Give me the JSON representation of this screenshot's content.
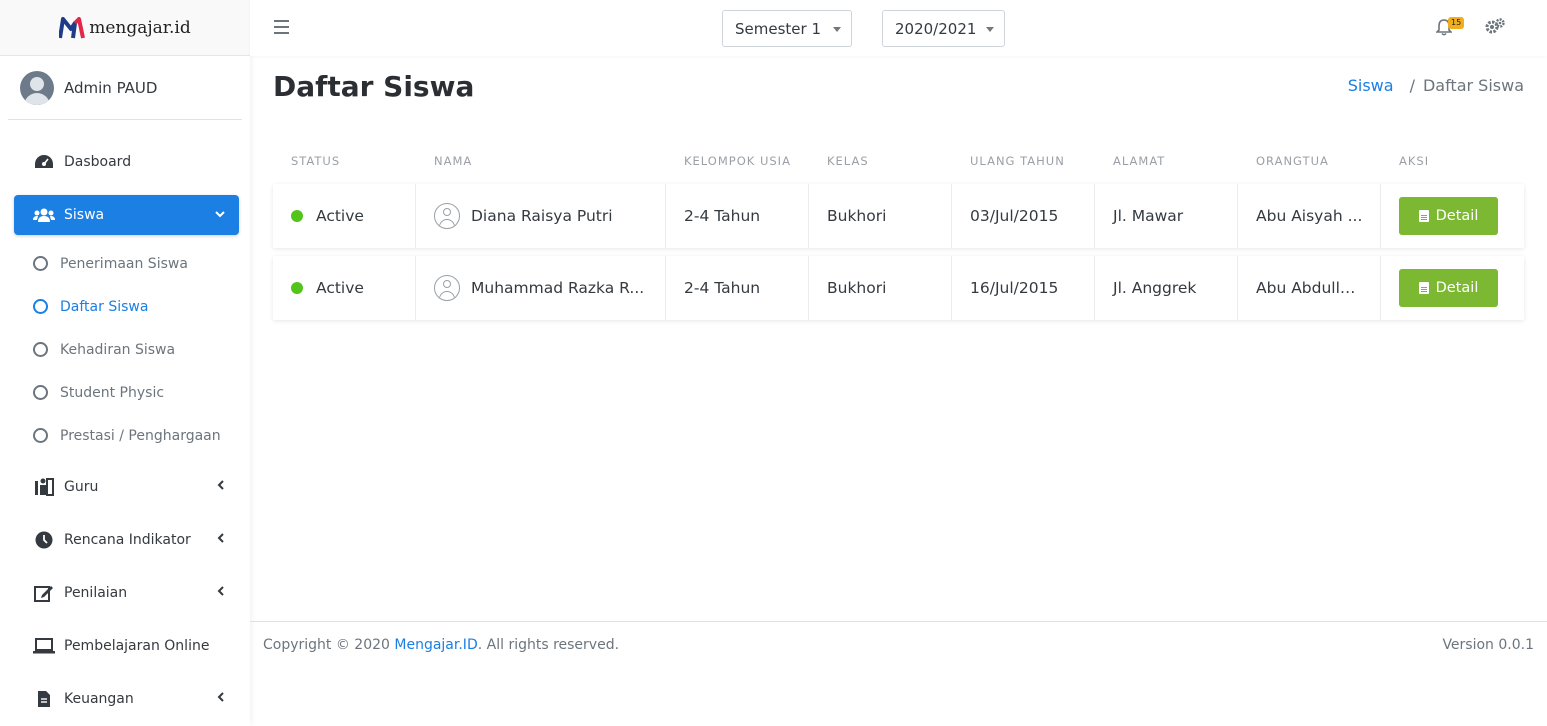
{
  "brand": {
    "name": "mengajar.id"
  },
  "user": {
    "name": "Admin PAUD"
  },
  "sidebar": {
    "items": [
      {
        "label": "Dasboard",
        "icon": "dashboard-icon"
      },
      {
        "label": "Siswa",
        "icon": "users-icon",
        "active": true
      },
      {
        "label": "Guru",
        "icon": "teacher-icon"
      },
      {
        "label": "Rencana Indikator",
        "icon": "clock-icon"
      },
      {
        "label": "Penilaian",
        "icon": "edit-icon"
      },
      {
        "label": "Pembelajaran Online",
        "icon": "laptop-icon"
      },
      {
        "label": "Keuangan",
        "icon": "file-icon"
      }
    ],
    "siswa_sub": [
      {
        "label": "Penerimaan Siswa"
      },
      {
        "label": "Daftar Siswa",
        "active": true
      },
      {
        "label": "Kehadiran Siswa"
      },
      {
        "label": "Student Physic"
      },
      {
        "label": "Prestasi / Penghargaan"
      }
    ]
  },
  "topbar": {
    "semester": "Semester 1",
    "year": "2020/2021",
    "notification_count": "15"
  },
  "page": {
    "title": "Daftar Siswa",
    "breadcrumb": {
      "link": "Siswa",
      "separator": "/",
      "current": "Daftar Siswa"
    }
  },
  "table": {
    "headers": [
      "STATUS",
      "NAMA",
      "KELOMPOK USIA",
      "KELAS",
      "ULANG TAHUN",
      "ALAMAT",
      "ORANGTUA",
      "AKSI"
    ],
    "rows": [
      {
        "status": "Active",
        "nama": "Diana Raisya Putri",
        "usia": "2-4 Tahun",
        "kelas": "Bukhori",
        "ulang_tahun": "03/Jul/2015",
        "alamat": "Jl. Mawar",
        "orangtua": "Abu Aisyah ...",
        "aksi": "Detail"
      },
      {
        "status": "Active",
        "nama": "Muhammad Razka R...",
        "usia": "2-4 Tahun",
        "kelas": "Bukhori",
        "ulang_tahun": "16/Jul/2015",
        "alamat": "Jl. Anggrek",
        "orangtua": "Abu Abdulla...",
        "aksi": "Detail"
      }
    ]
  },
  "footer": {
    "copyright_prefix": "Copyright © 2020 ",
    "link": "Mengajar.ID",
    "copyright_suffix": ". All rights reserved.",
    "version": "Version 0.0.1"
  },
  "colors": {
    "primary": "#1b7fe4",
    "success": "#7cb832",
    "status_active": "#52c41a",
    "badge": "#f0ad1e"
  }
}
